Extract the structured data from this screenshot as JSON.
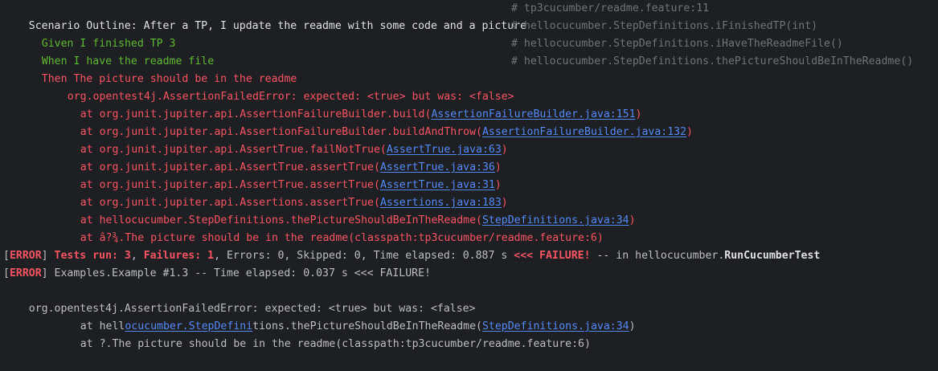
{
  "scenario": {
    "text": "Scenario Outline: After a TP, I update the readme with some code and a picture",
    "comment": "# tp3cucumber/readme.feature:11"
  },
  "steps": [
    {
      "text": "Given I finished TP 3",
      "comment": "# hellocucumber.StepDefinitions.iFinishedTP(int)",
      "status": "passed"
    },
    {
      "text": "When I have the readme file",
      "comment": "# hellocucumber.StepDefinitions.iHaveTheReadmeFile()",
      "status": "passed"
    },
    {
      "text": "Then The picture should be in the readme",
      "comment": "# hellocucumber.StepDefinitions.thePictureShouldBeInTheReadme()",
      "status": "failed"
    }
  ],
  "error_header": "org.opentest4j.AssertionFailedError: expected: <true> but was: <false>",
  "stack": [
    {
      "pre": "at org.junit.jupiter.api.AssertionFailureBuilder.build(",
      "link": "AssertionFailureBuilder.java:151",
      "post": ")"
    },
    {
      "pre": "at org.junit.jupiter.api.AssertionFailureBuilder.buildAndThrow(",
      "link": "AssertionFailureBuilder.java:132",
      "post": ")"
    },
    {
      "pre": "at org.junit.jupiter.api.AssertTrue.failNotTrue(",
      "link": "AssertTrue.java:63",
      "post": ")"
    },
    {
      "pre": "at org.junit.jupiter.api.AssertTrue.assertTrue(",
      "link": "AssertTrue.java:36",
      "post": ")"
    },
    {
      "pre": "at org.junit.jupiter.api.AssertTrue.assertTrue(",
      "link": "AssertTrue.java:31",
      "post": ")"
    },
    {
      "pre": "at org.junit.jupiter.api.Assertions.assertTrue(",
      "link": "Assertions.java:183",
      "post": ")"
    },
    {
      "pre": "at hellocucumber.StepDefinitions.thePictureShouldBeInTheReadme(",
      "link": "StepDefinitions.java:34",
      "post": ")"
    }
  ],
  "stack_last": "at â?¾.The picture should be in the readme(classpath:tp3cucumber/readme.feature:6)",
  "summary1": {
    "tag": "ERROR",
    "tests_run_label": "Tests run: ",
    "tests_run": "3",
    "failures_label": "Failures: ",
    "failures": "1",
    "rest": ", Errors: 0, Skipped: 0, Time elapsed: 0.887 s ",
    "failure_marker": "<<< FAILURE!",
    "in_text": " -- in hellocucumber.",
    "class_name": "RunCucumberTest"
  },
  "summary2": {
    "tag": "ERROR",
    "text": " Examples.Example #1.3 -- Time elapsed: 0.037 s <<< FAILURE!"
  },
  "error_footer": "org.opentest4j.AssertionFailedError: expected: <true> but was: <false>",
  "footer_stack1": {
    "pre": "at hell",
    "link": "ocucumber.StepDefini",
    "mid": "tions.thePictureShouldBeInTheReadme(",
    "link2": "StepDefinitions.java:34",
    "post": ")"
  },
  "footer_stack2": "at ?.The picture should be in the readme(classpath:tp3cucumber/readme.feature:6)"
}
